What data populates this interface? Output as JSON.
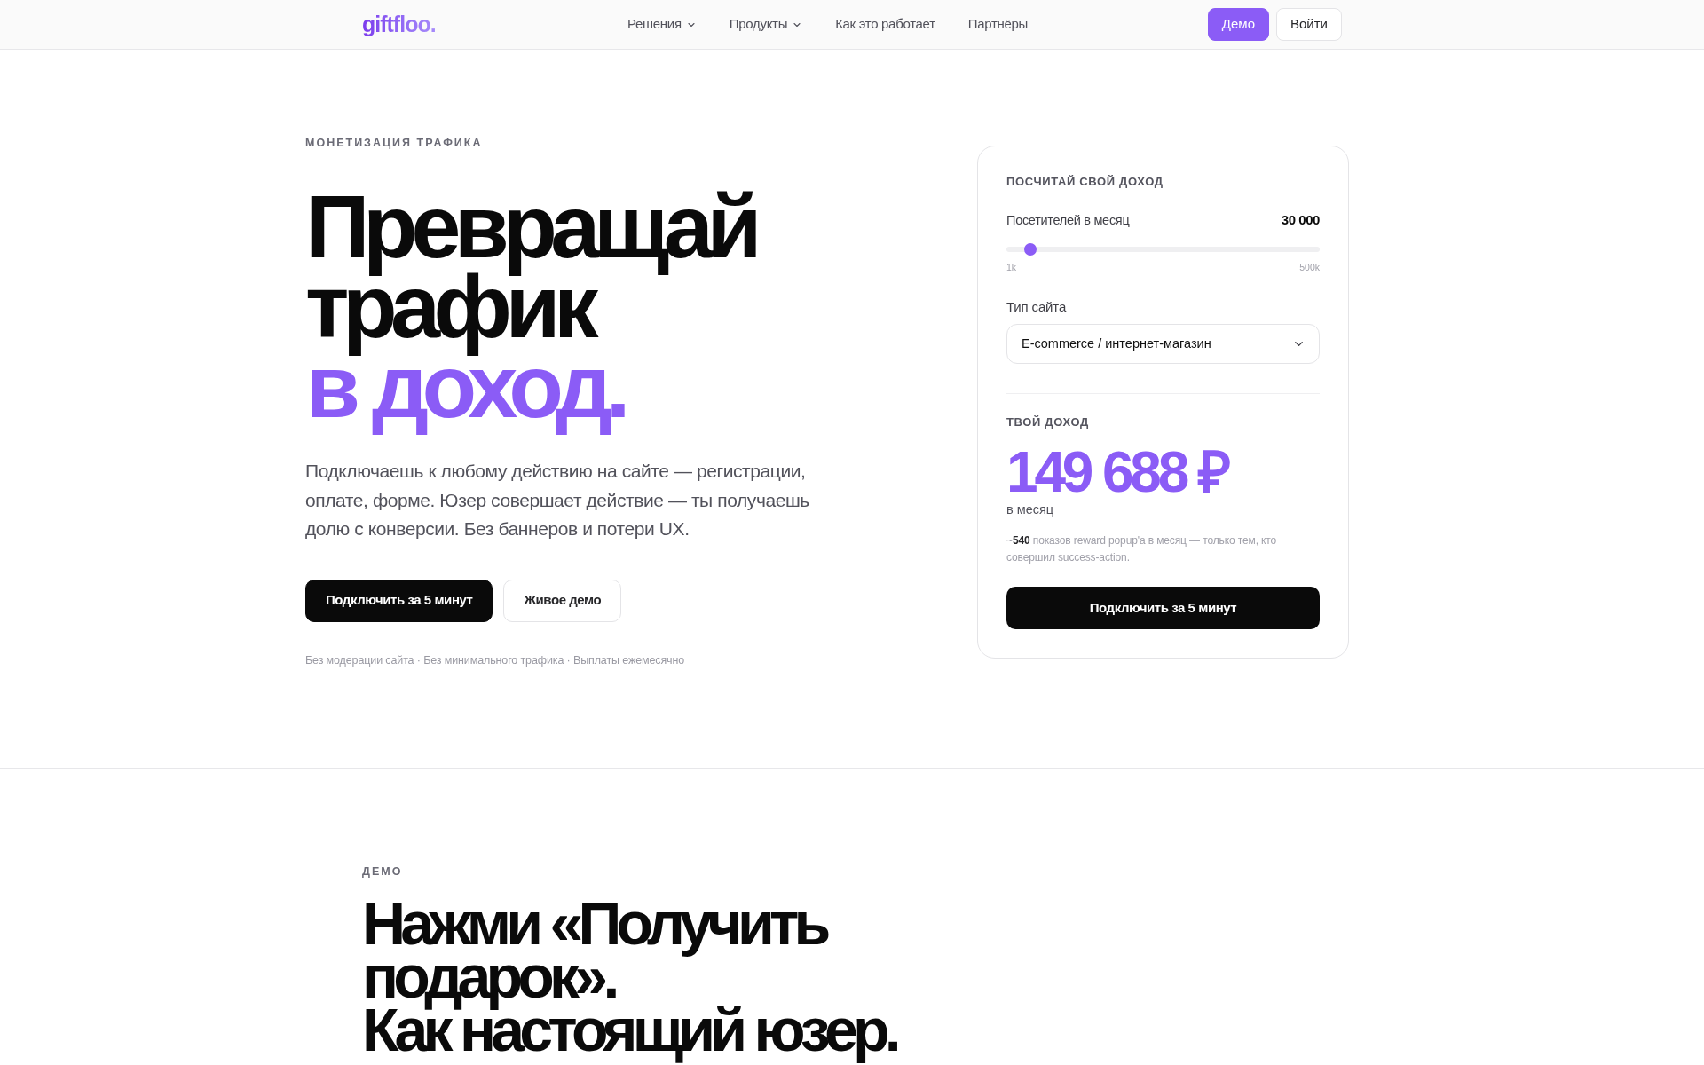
{
  "nav": {
    "logo": "giftfloo.",
    "links": [
      {
        "label": "Решения",
        "has_menu": true
      },
      {
        "label": "Продукты",
        "has_menu": true
      },
      {
        "label": "Как это работает",
        "has_menu": false
      },
      {
        "label": "Партнёры",
        "has_menu": false
      }
    ],
    "buttons": [
      {
        "label": "Демо",
        "kind": "accent"
      },
      {
        "label": "Войти",
        "kind": "outline"
      }
    ]
  },
  "hero": {
    "eyebrow": "МОНЕТИЗАЦИЯ ТРАФИКА",
    "headline": [
      {
        "text": "Превращай",
        "accent": false
      },
      {
        "text": "трафик",
        "accent": false
      },
      {
        "text": "в доход.",
        "accent": true
      }
    ],
    "description": "Подключаешь к любому действию на сайте — регистрации, оплате, форме. Юзер совершает действие — ты получаешь долю с конверсии. Без баннеров и потери UX.",
    "buttons": [
      {
        "label": "Подключить за 5 минут",
        "kind": "dark"
      },
      {
        "label": "Живое демо",
        "kind": "outline"
      }
    ],
    "footnote": "Без модерации сайта · Без минимального трафика · Выплаты ежемесячно"
  },
  "calculator": {
    "title": "ПОСЧИТАЙ СВОЙ ДОХОД",
    "visitors": {
      "label": "Посетителей в месяц",
      "value": "30 000",
      "level": 0.058,
      "min_label": "1k",
      "max_label": "500k"
    },
    "site_type": {
      "label": "Тип сайта",
      "value": "E-commerce / интернет-магазин"
    },
    "result": {
      "label": "ТВОЙ ДОХОД",
      "amount": "149 688 ₽",
      "period": "в месяц",
      "note": "~**540** показов reward popup'a в месяц — только тем, кто совершил success-action."
    },
    "button": "Подключить за 5 минут"
  },
  "demo": {
    "eyebrow": "ДЕМО",
    "title_lines": [
      "Нажми «Получить",
      "подарок».",
      "Как настоящий юзер."
    ]
  }
}
